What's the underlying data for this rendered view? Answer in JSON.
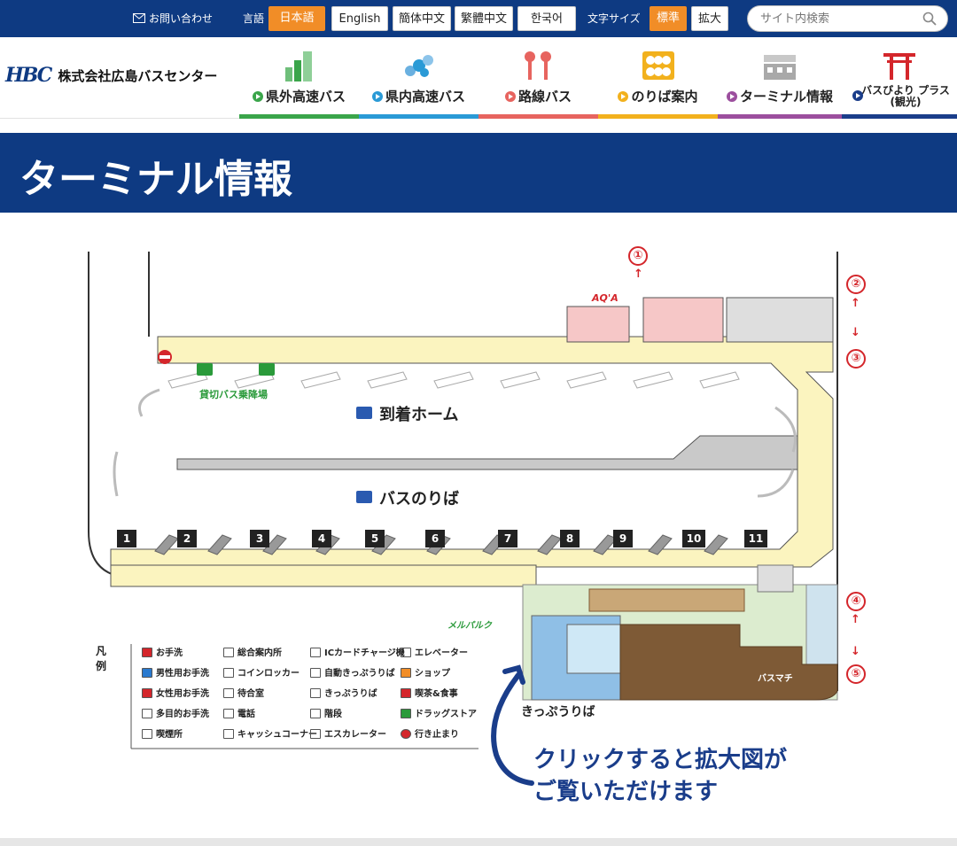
{
  "topbar": {
    "contact": "お問い合わせ",
    "language_label": "言語",
    "languages": [
      "日本語",
      "English",
      "簡体中文",
      "繁體中文",
      "한국어"
    ],
    "font_size_label": "文字サイズ",
    "font_sizes": [
      "標準",
      "拡大"
    ],
    "search_placeholder": "サイト内検索"
  },
  "header": {
    "logo_mark": "HBC",
    "company": "株式会社広島バスセンター",
    "nav": [
      {
        "label": "県外高速バス",
        "color": "#3aa54a"
      },
      {
        "label": "県内高速バス",
        "color": "#2a9ad6"
      },
      {
        "label": "路線バス",
        "color": "#e7645f"
      },
      {
        "label": "のりば案内",
        "color": "#f2b11d"
      },
      {
        "label": "ターミナル情報",
        "color": "#9c4f9e"
      },
      {
        "label": "バスびより プラス(観光)",
        "color": "#1a3d8a"
      }
    ]
  },
  "page": {
    "title": "ターミナル情報"
  },
  "map": {
    "arrival_hall": "到着ホーム",
    "departure_hall": "バスのりば",
    "charter": "貸切バス乗降場",
    "ticket_office": "きっぷうりば",
    "aqua": "AQ'A",
    "mall": "メルパルク",
    "basmachi": "バスマチ",
    "gates": [
      "1",
      "2",
      "3",
      "4",
      "5",
      "6",
      "7",
      "8",
      "9",
      "10",
      "11"
    ],
    "exits": [
      "①",
      "②",
      "③",
      "④",
      "⑤"
    ]
  },
  "legend": {
    "title": "凡例",
    "items": [
      "お手洗",
      "男性用お手洗",
      "女性用お手洗",
      "多目的お手洗",
      "喫煙所",
      "総合案内所",
      "コインロッカー",
      "待合室",
      "電話",
      "キャッシュコーナー",
      "ICカードチャージ機",
      "自動きっぷうりば",
      "きっぷうりば",
      "階段",
      "エスカレーター",
      "エレベーター",
      "ショップ",
      "喫茶&食事",
      "ドラッグストア",
      "行き止まり"
    ]
  },
  "note": {
    "line1": "クリックすると拡大図が",
    "line2": "ご覧いただけます"
  }
}
